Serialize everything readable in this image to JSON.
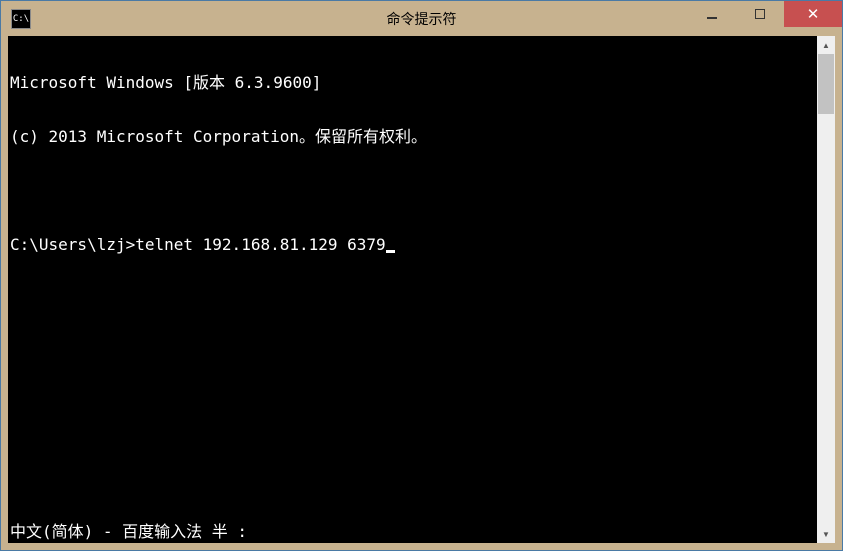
{
  "window": {
    "title": "命令提示符",
    "icon_label": "C:\\"
  },
  "terminal": {
    "lines": [
      "Microsoft Windows [版本 6.3.9600]",
      "(c) 2013 Microsoft Corporation。保留所有权利。",
      "",
      "C:\\Users\\lzj>telnet 192.168.81.129 6379"
    ],
    "prompt_prefix": "C:\\Users\\lzj>",
    "command": "telnet 192.168.81.129 6379"
  },
  "ime_status": "中文(简体) - 百度输入法 半 :",
  "controls": {
    "close_glyph": "✕",
    "up_glyph": "▲",
    "down_glyph": "▼"
  }
}
